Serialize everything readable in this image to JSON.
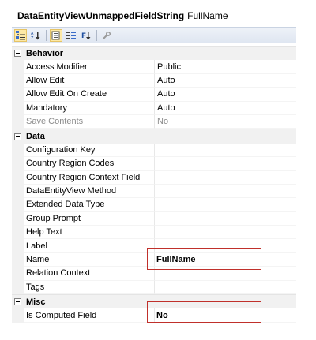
{
  "header": {
    "type": "DataEntityViewUnmappedFieldString",
    "name": "FullName"
  },
  "toolbar": {
    "buttons": [
      "categorized-icon",
      "alphabetical-icon",
      "properties-icon",
      "events-icon",
      "sort-icon",
      "settings-icon"
    ]
  },
  "categories": [
    {
      "label": "Behavior",
      "props": [
        {
          "name": "Access Modifier",
          "value": "Public"
        },
        {
          "name": "Allow Edit",
          "value": "Auto"
        },
        {
          "name": "Allow Edit On Create",
          "value": "Auto"
        },
        {
          "name": "Mandatory",
          "value": "Auto"
        },
        {
          "name": "Save Contents",
          "value": "No"
        }
      ]
    },
    {
      "label": "Data",
      "props": [
        {
          "name": "Configuration Key",
          "value": ""
        },
        {
          "name": "Country Region Codes",
          "value": ""
        },
        {
          "name": "Country Region Context Field",
          "value": ""
        },
        {
          "name": "DataEntityView Method",
          "value": ""
        },
        {
          "name": "Extended Data Type",
          "value": ""
        },
        {
          "name": "Group Prompt",
          "value": ""
        },
        {
          "name": "Help Text",
          "value": ""
        },
        {
          "name": "Label",
          "value": ""
        },
        {
          "name": "Name",
          "value": "FullName"
        },
        {
          "name": "Relation Context",
          "value": ""
        },
        {
          "name": "Tags",
          "value": ""
        }
      ]
    },
    {
      "label": "Misc",
      "props": [
        {
          "name": "Is Computed Field",
          "value": "No"
        }
      ]
    }
  ],
  "colors": {
    "highlight_border": "#c0302b",
    "toolbar_bg": "#e3e9f3",
    "category_bg": "#f1f1f1"
  }
}
